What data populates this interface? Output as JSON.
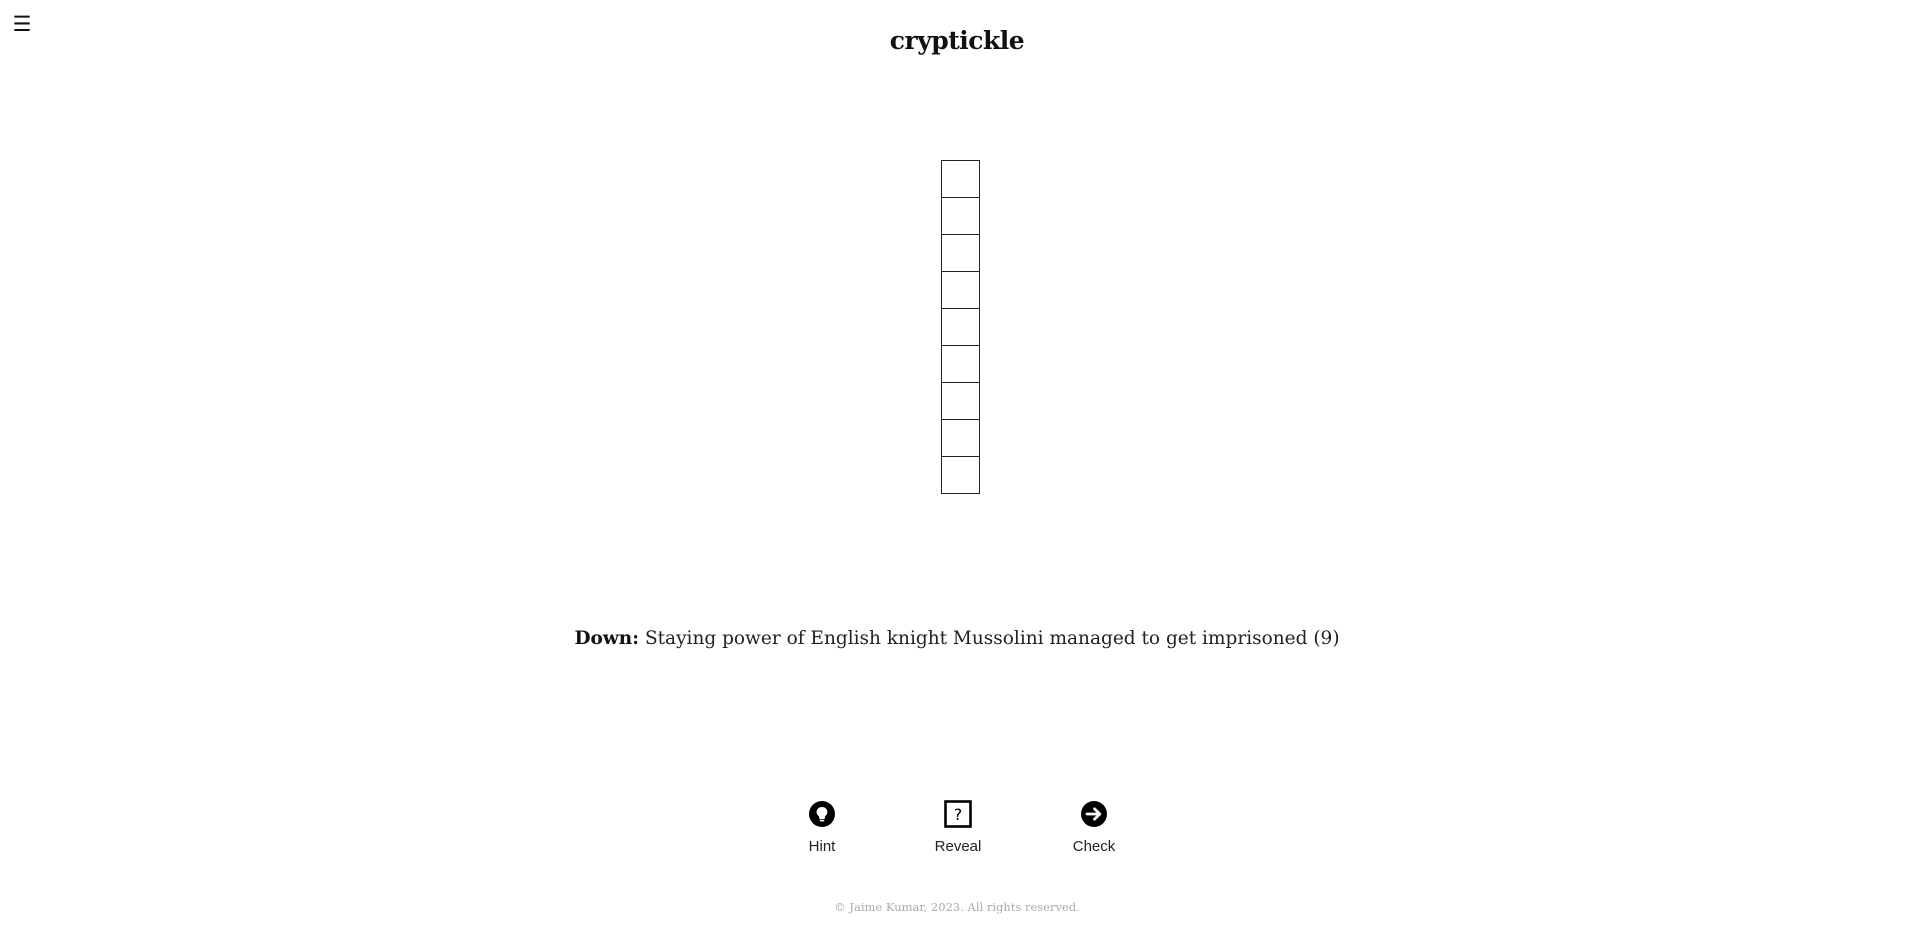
{
  "header": {
    "menu_glyph": "☰",
    "title": "cryptickle"
  },
  "grid": {
    "orientation": "down",
    "cell_count": 9,
    "cells": [
      "",
      "",
      "",
      "",
      "",
      "",
      "",
      "",
      ""
    ]
  },
  "clue": {
    "direction": "Down:",
    "text": "Staying power of English knight Mussolini managed to get imprisoned (9)"
  },
  "actions": [
    {
      "label": "Hint",
      "icon": "lightbulb-icon"
    },
    {
      "label": "Reveal",
      "icon": "question-box-icon"
    },
    {
      "label": "Check",
      "icon": "arrow-right-circle-icon"
    }
  ],
  "footer": {
    "text": "© Jaime Kumar, 2023. All rights reserved."
  }
}
